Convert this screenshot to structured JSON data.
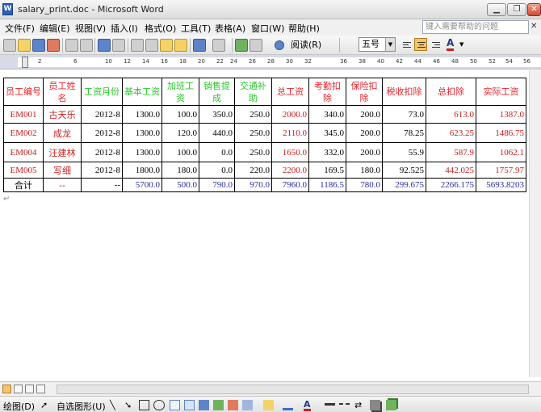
{
  "window": {
    "title": "salary_print.doc - Microsoft Word",
    "icon": "word-app-icon",
    "controls": [
      "minimize",
      "restore",
      "close"
    ]
  },
  "menu": {
    "items": [
      "文件(F)",
      "编辑(E)",
      "视图(V)",
      "插入(I)",
      "格式(O)",
      "工具(T)",
      "表格(A)",
      "窗口(W)",
      "帮助(H)"
    ],
    "help_placeholder": "键入需要帮助的问题"
  },
  "toolbar": {
    "read_label": "阅读(R)",
    "font_size": "五号",
    "icons": [
      "new-icon",
      "open-icon",
      "save-icon",
      "permission-icon",
      "print-icon",
      "print-preview-icon",
      "spelling-icon",
      "research-icon",
      "cut-icon",
      "copy-icon",
      "paste-icon",
      "format-painter-icon",
      "undo-icon",
      "redo-icon",
      "hyperlink-icon",
      "tables-borders-icon",
      "help-icon",
      "align-left-icon",
      "align-center-icon",
      "align-right-icon",
      "font-color-icon"
    ]
  },
  "ruler": {
    "ticks": [
      "2",
      "6",
      "10",
      "12",
      "14",
      "16",
      "18",
      "20",
      "22",
      "24",
      "26",
      "28",
      "30",
      "32",
      "36",
      "38",
      "40",
      "42",
      "44",
      "46",
      "48",
      "50",
      "52",
      "54",
      "56"
    ]
  },
  "table": {
    "headers": [
      "员工编号",
      "员工姓名",
      "工资月份",
      "基本工资",
      "加班工资",
      "销售提成",
      "交通补助",
      "总工资",
      "考勤扣除",
      "保险扣除",
      "税收扣除",
      "总扣除",
      "实际工资"
    ],
    "rows": [
      [
        "EM001",
        "古天乐",
        "2012-8",
        "1300.0",
        "100.0",
        "350.0",
        "250.0",
        "2000.0",
        "340.0",
        "200.0",
        "73.0",
        "613.0",
        "1387.0"
      ],
      [
        "EM002",
        "成龙",
        "2012-8",
        "1300.0",
        "120.0",
        "440.0",
        "250.0",
        "2110.0",
        "345.0",
        "200.0",
        "78.25",
        "623.25",
        "1486.75"
      ],
      [
        "EM004",
        "汪建林",
        "2012-8",
        "1300.0",
        "100.0",
        "0.0",
        "250.0",
        "1650.0",
        "332.0",
        "200.0",
        "55.9",
        "587.9",
        "1062.1"
      ],
      [
        "EM005",
        "写细",
        "2012-8",
        "1800.0",
        "180.0",
        "0.0",
        "220.0",
        "2200.0",
        "169.5",
        "180.0",
        "92.525",
        "442.025",
        "1757.97"
      ]
    ],
    "total": [
      "合计",
      "--",
      "--",
      "5700.0",
      "500.0",
      "790.0",
      "970.0",
      "7960.0",
      "1186.5",
      "780.0",
      "299.675",
      "2266.175",
      "5693.8203"
    ]
  },
  "drawing_toolbar": {
    "draw_label": "绘图(D)",
    "autoshapes_label": "自选图形(U)"
  }
}
